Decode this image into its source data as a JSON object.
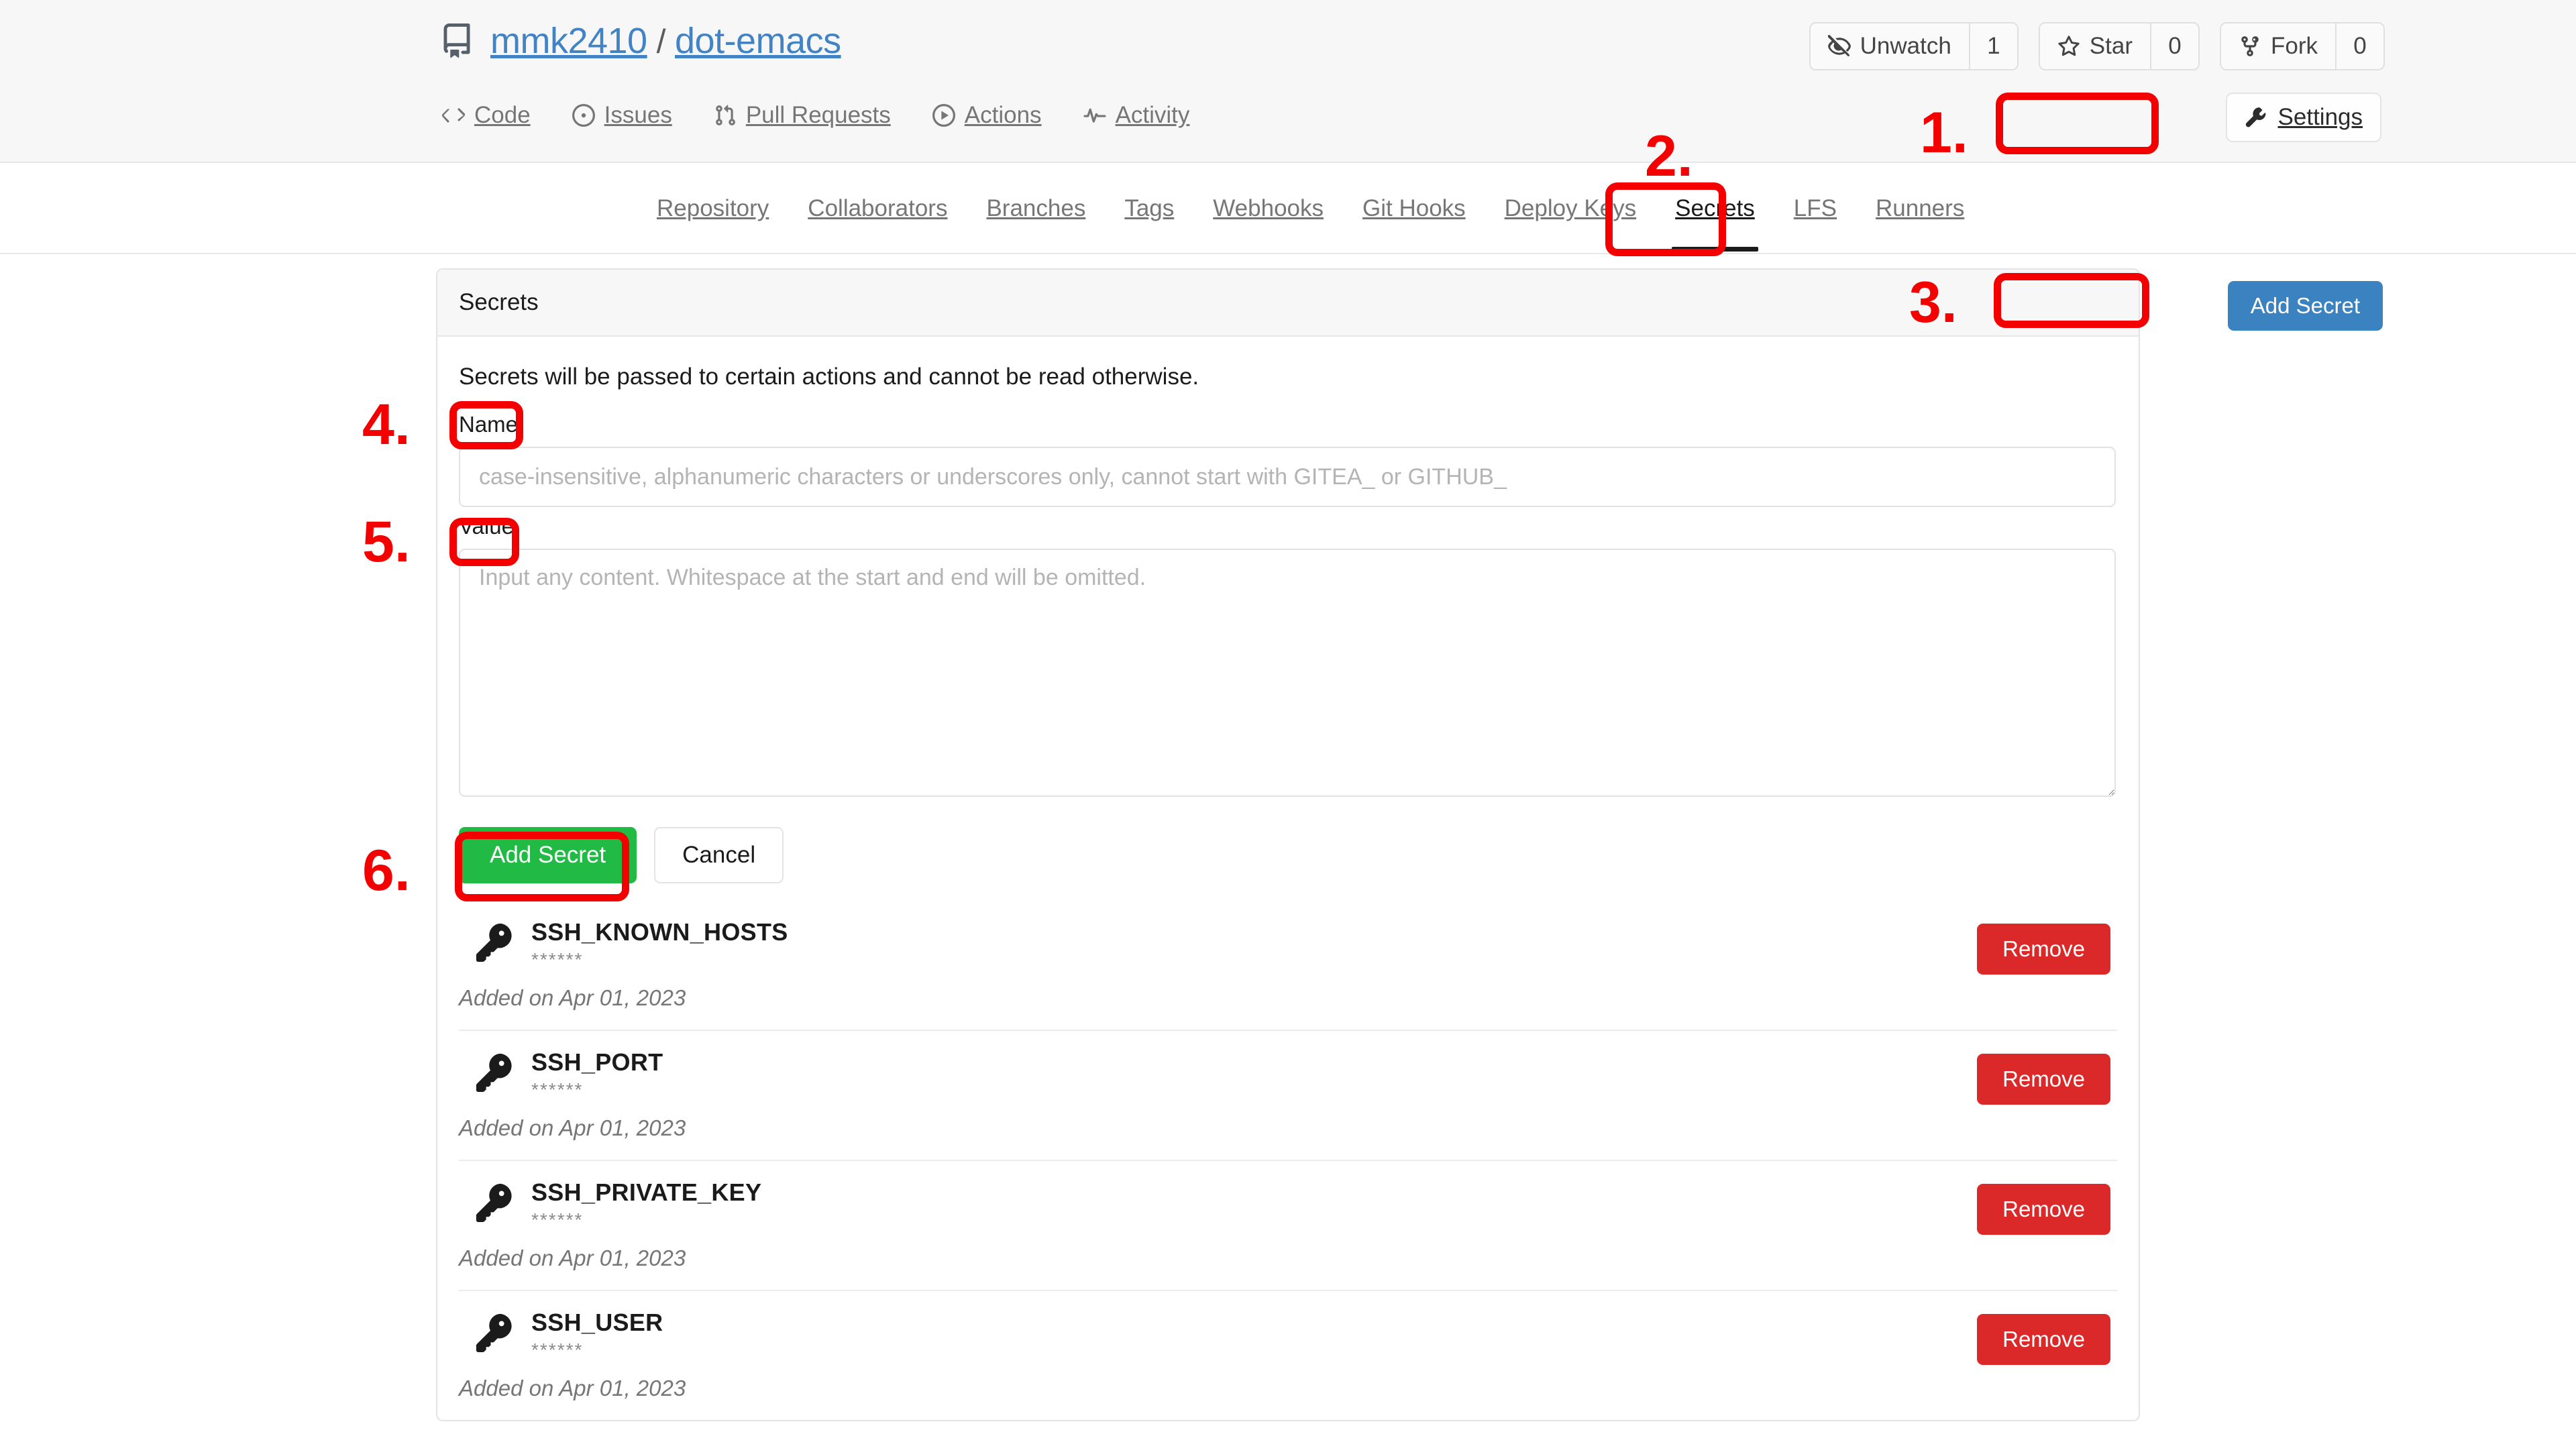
{
  "repo": {
    "icon": "repo-icon",
    "owner": "mmk2410",
    "separator": "/",
    "name": "dot-emacs"
  },
  "repo_actions": [
    {
      "icon": "unwatch-icon",
      "label": "Unwatch",
      "count": "1"
    },
    {
      "icon": "star-icon",
      "label": "Star",
      "count": "0"
    },
    {
      "icon": "fork-icon",
      "label": "Fork",
      "count": "0"
    }
  ],
  "repo_nav": [
    {
      "icon": "code-icon",
      "label": "Code"
    },
    {
      "icon": "issues-icon",
      "label": "Issues"
    },
    {
      "icon": "pull-requests-icon",
      "label": "Pull Requests"
    },
    {
      "icon": "actions-icon",
      "label": "Actions"
    },
    {
      "icon": "activity-icon",
      "label": "Activity"
    }
  ],
  "settings_button": {
    "icon": "wrench-icon",
    "label": "Settings"
  },
  "settings_nav": [
    {
      "label": "Repository",
      "active": false
    },
    {
      "label": "Collaborators",
      "active": false
    },
    {
      "label": "Branches",
      "active": false
    },
    {
      "label": "Tags",
      "active": false
    },
    {
      "label": "Webhooks",
      "active": false
    },
    {
      "label": "Git Hooks",
      "active": false
    },
    {
      "label": "Deploy Keys",
      "active": false
    },
    {
      "label": "Secrets",
      "active": true
    },
    {
      "label": "LFS",
      "active": false
    },
    {
      "label": "Runners",
      "active": false
    }
  ],
  "panel": {
    "title": "Secrets",
    "add_secret_header_button": "Add Secret",
    "description": "Secrets will be passed to certain actions and cannot be read otherwise.",
    "name_label": "Name",
    "name_value": "",
    "name_placeholder": "case-insensitive, alphanumeric characters or underscores only, cannot start with GITEA_ or GITHUB_",
    "value_label": "Value",
    "value_value": "",
    "value_placeholder": "Input any content. Whitespace at the start and end will be omitted.",
    "submit_label": "Add Secret",
    "cancel_label": "Cancel",
    "remove_label": "Remove"
  },
  "secrets": [
    {
      "icon": "key-icon",
      "name": "SSH_KNOWN_HOSTS",
      "mask": "******",
      "added": "Added on Apr 01, 2023",
      "remove": "Remove"
    },
    {
      "icon": "key-icon",
      "name": "SSH_PORT",
      "mask": "******",
      "added": "Added on Apr 01, 2023",
      "remove": "Remove"
    },
    {
      "icon": "key-icon",
      "name": "SSH_PRIVATE_KEY",
      "mask": "******",
      "added": "Added on Apr 01, 2023",
      "remove": "Remove"
    },
    {
      "icon": "key-icon",
      "name": "SSH_USER",
      "mask": "******",
      "added": "Added on Apr 01, 2023",
      "remove": "Remove"
    }
  ],
  "annotations": [
    {
      "label": "1.",
      "target": "settings-button"
    },
    {
      "label": "2.",
      "target": "secrets-tab"
    },
    {
      "label": "3.",
      "target": "add-secret-header-button"
    },
    {
      "label": "4.",
      "target": "name-label"
    },
    {
      "label": "5.",
      "target": "value-label"
    },
    {
      "label": "6.",
      "target": "add-secret-submit-button"
    }
  ],
  "colors": {
    "link": "#4183c4",
    "primary_blue": "#3b83c0",
    "success_green": "#21ba45",
    "danger_red": "#db2828",
    "annotation_red": "#f40000",
    "header_bg": "#f7f7f8"
  }
}
